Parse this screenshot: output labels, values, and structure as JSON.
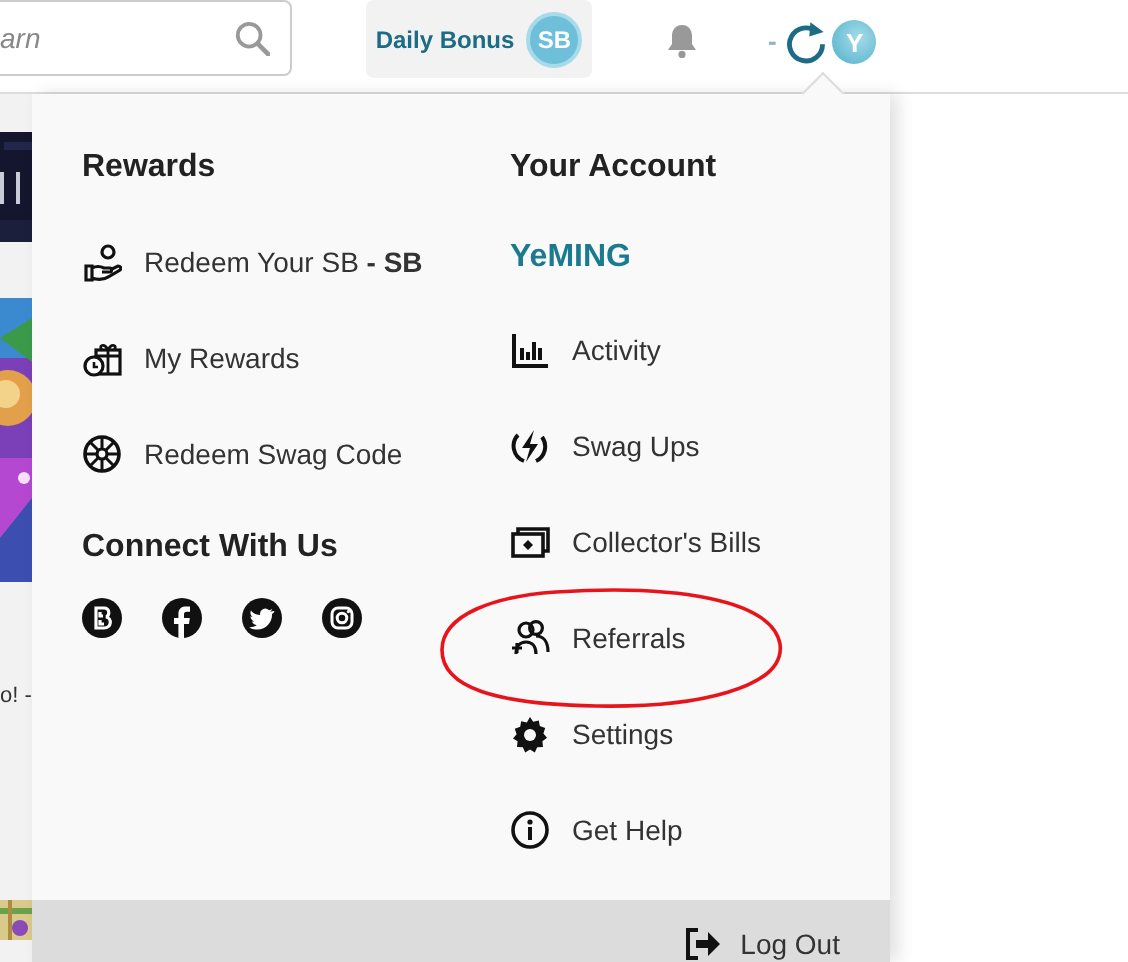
{
  "header": {
    "search": {
      "placeholder": "arn"
    },
    "daily_bonus": {
      "label": "Daily Bonus",
      "badge": "SB"
    },
    "balance": "-",
    "avatar": "Y"
  },
  "background": {
    "snippet": "o! -"
  },
  "menu": {
    "rewards": {
      "heading": "Rewards",
      "items": [
        {
          "label": "Redeem Your SB **- SB**"
        },
        {
          "label": "My Rewards"
        },
        {
          "label": "Redeem Swag Code"
        }
      ]
    },
    "connect": {
      "heading": "Connect With Us"
    },
    "account": {
      "heading": "Your Account",
      "username": "YeMING",
      "items": [
        {
          "label": "Activity"
        },
        {
          "label": "Swag Ups"
        },
        {
          "label": "Collector's Bills"
        },
        {
          "label": "Referrals"
        },
        {
          "label": "Settings"
        },
        {
          "label": "Get Help"
        }
      ]
    },
    "logout": "Log Out"
  }
}
